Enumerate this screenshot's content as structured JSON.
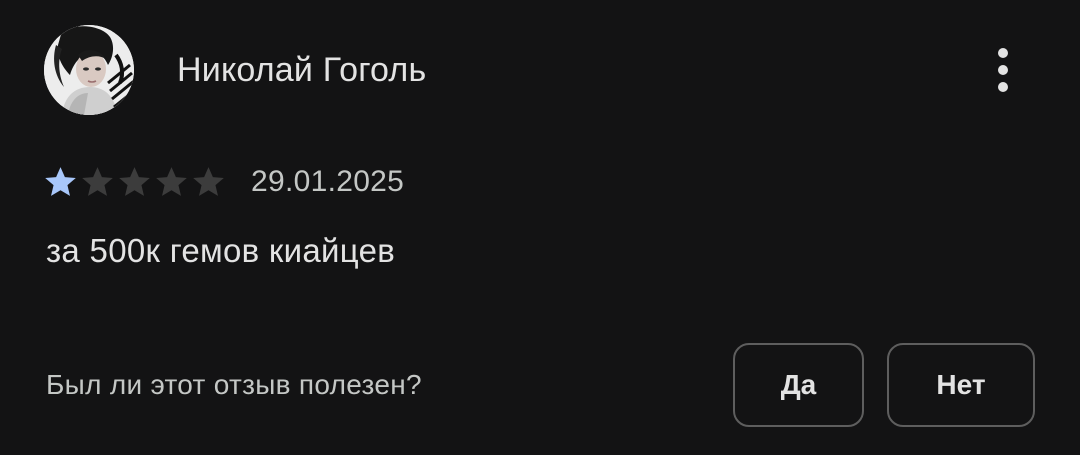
{
  "review": {
    "author": "Николай Гоголь",
    "avatar_icon": "user-avatar-photo",
    "more_icon": "more-vert-icon",
    "rating": 1,
    "rating_max": 5,
    "date": "29.01.2025",
    "text": "за 500к гемов киайцев"
  },
  "helpful": {
    "question": "Был ли этот отзыв полезен?",
    "yes_label": "Да",
    "no_label": "Нет"
  },
  "colors": {
    "background": "#131314",
    "star_filled": "#a8c7fa",
    "star_empty": "#3c3c3c",
    "button_border": "#5e5e5e"
  }
}
